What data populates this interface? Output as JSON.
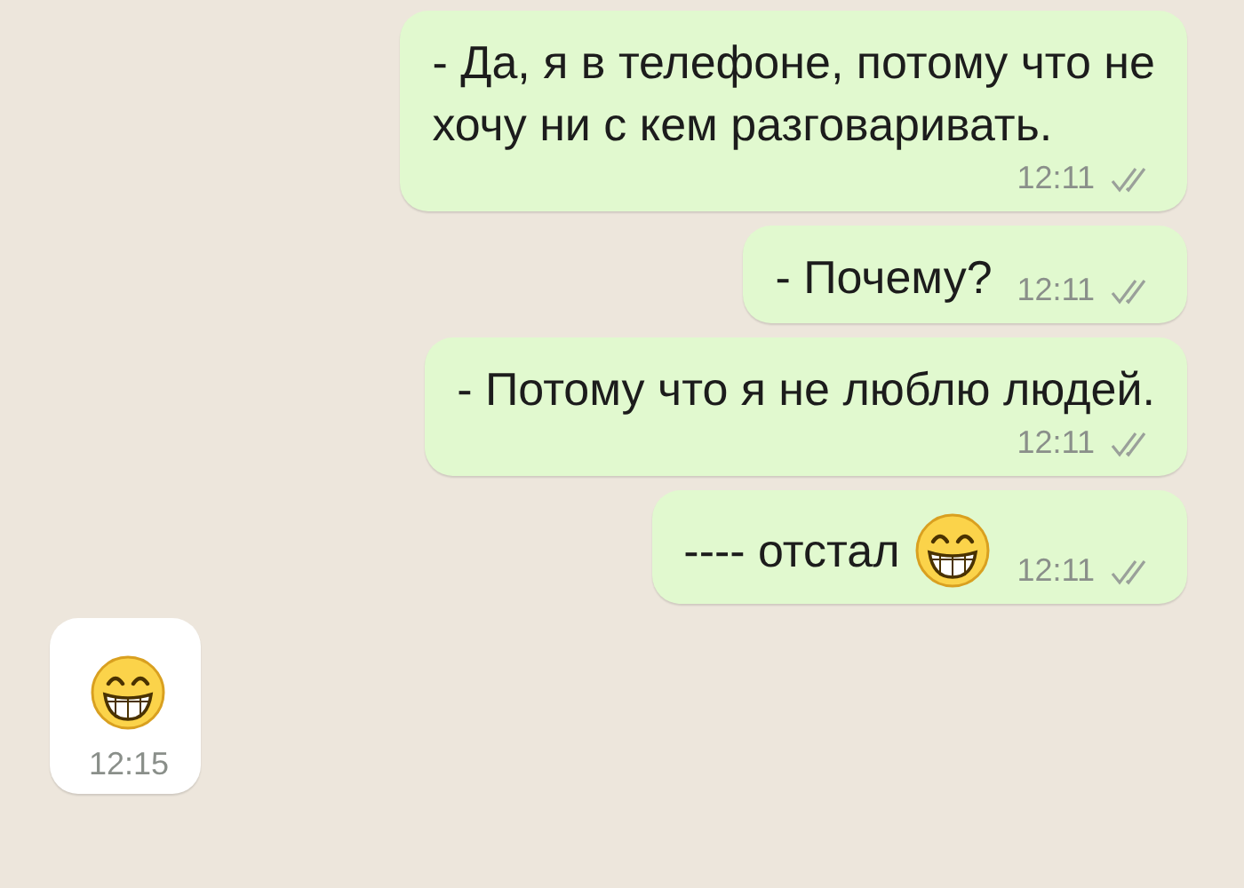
{
  "messages": [
    {
      "kind": "wide",
      "lines": [
        "- Да, я в телефоне, потому что не",
        "хочу ни с кем разговаривать."
      ],
      "time": "12:11",
      "read": false
    },
    {
      "kind": "compact",
      "lines": [
        "- Почему?"
      ],
      "time": "12:11",
      "read": false
    },
    {
      "kind": "wide",
      "lines": [
        "- Потому что я не люблю людей."
      ],
      "time": "12:11",
      "read": false
    },
    {
      "kind": "compact",
      "lines": [
        "---- отстал"
      ],
      "emoji": true,
      "time": "12:11",
      "read": false
    },
    {
      "kind": "incoming",
      "emoji": true,
      "time": "12:15"
    }
  ]
}
